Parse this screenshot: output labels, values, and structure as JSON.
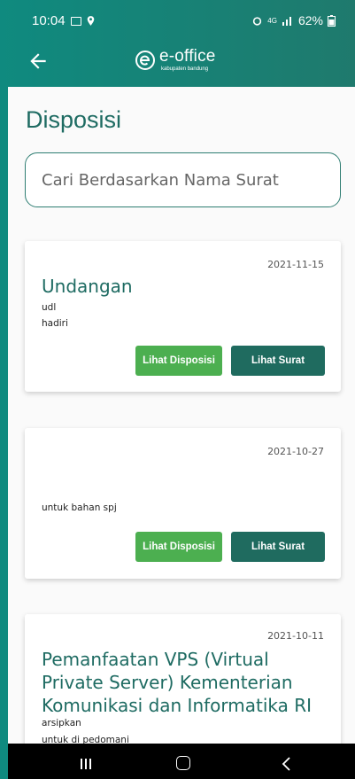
{
  "status": {
    "time": "10:04",
    "network": "4G",
    "battery": "62%"
  },
  "appbar": {
    "logo_name": "e-office",
    "logo_sub": "kabupaten bandung"
  },
  "page": {
    "title": "Disposisi"
  },
  "search": {
    "placeholder": "Cari Berdasarkan Nama Surat"
  },
  "cards": [
    {
      "date": "2021-11-15",
      "subject": "Undangan",
      "line1": "udl",
      "line2": "hadiri",
      "btn_disposisi": "Lihat Disposisi",
      "btn_surat": "Lihat Surat"
    },
    {
      "date": "2021-10-27",
      "subject": "",
      "line1": "",
      "line2": "untuk bahan spj",
      "btn_disposisi": "Lihat Disposisi",
      "btn_surat": "Lihat Surat"
    },
    {
      "date": "2021-10-11",
      "subject": "Pemanfaatan VPS (Virtual Private Server) Kementerian Komunikasi dan Informatika RI",
      "line1": "arsipkan",
      "line2": "untuk di pedomani"
    }
  ],
  "colors": {
    "brand": "#1f7a6d",
    "title": "#1e6b62",
    "btn_green": "#4caf50",
    "btn_teal": "#1f6b5f"
  }
}
